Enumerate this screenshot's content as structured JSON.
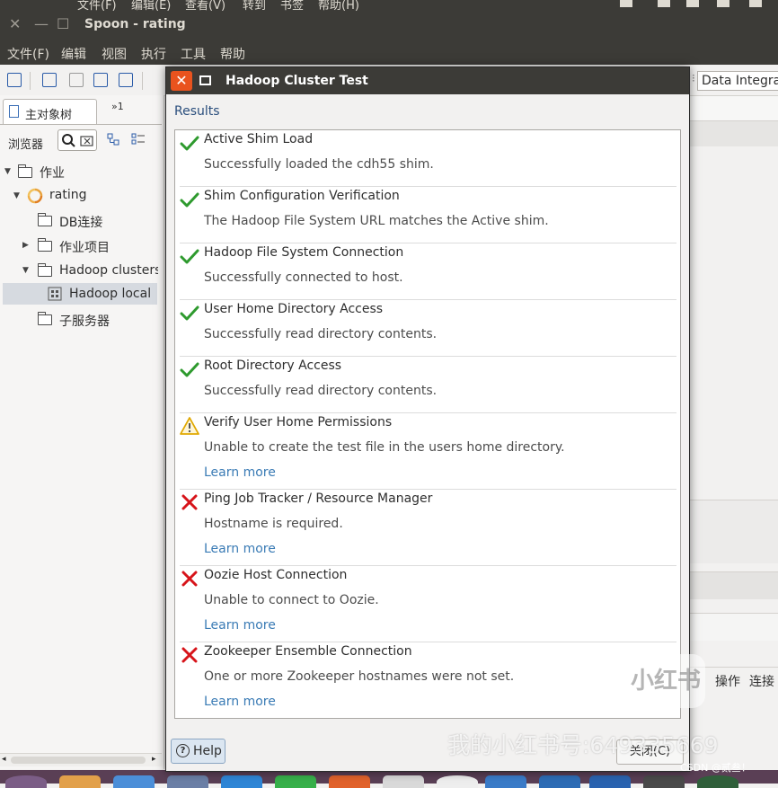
{
  "system_menu": [
    "文件(F)",
    "编辑(E)",
    "查看(V)",
    "转到",
    "书签",
    "帮助(H)"
  ],
  "window": {
    "title": "Spoon - rating"
  },
  "menubar": [
    "文件(F)",
    "编辑",
    "视图",
    "执行",
    "工具",
    "帮助"
  ],
  "right_panel": {
    "perspective": "Data Integration",
    "btn_text": "操作",
    "btn_text2": "连接"
  },
  "left_panel": {
    "tab_main": "主对象树",
    "tab_more": "»1",
    "browser_label": "浏览器",
    "tree": [
      {
        "label": "作业",
        "expanded": true
      },
      {
        "label": "rating",
        "expanded": true
      },
      {
        "label": "DB连接"
      },
      {
        "label": "作业项目",
        "expanded": false
      },
      {
        "label": "Hadoop clusters",
        "expanded": true
      },
      {
        "label": "Hadoop local",
        "selected": true
      },
      {
        "label": "子服务器"
      }
    ]
  },
  "dialog": {
    "title": "Hadoop Cluster Test",
    "results_label": "Results",
    "items": [
      {
        "name": "Active Shim Load",
        "message": "Successfully loaded the cdh55 shim.",
        "status": "success"
      },
      {
        "name": "Shim Configuration Verification",
        "message": "The Hadoop File System URL matches the Active shim.",
        "status": "success"
      },
      {
        "name": "Hadoop File System Connection",
        "message": "Successfully connected to host.",
        "status": "success"
      },
      {
        "name": "User Home Directory Access",
        "message": "Successfully read directory contents.",
        "status": "success"
      },
      {
        "name": "Root Directory Access",
        "message": "Successfully read directory contents.",
        "status": "success"
      },
      {
        "name": "Verify User Home Permissions",
        "message": "Unable to create the test file in the users home directory.",
        "status": "warning",
        "link": "Learn more"
      },
      {
        "name": "Ping Job Tracker / Resource Manager",
        "message": "Hostname is required.",
        "status": "error",
        "link": "Learn more"
      },
      {
        "name": "Oozie Host Connection",
        "message": "Unable to connect to Oozie.",
        "status": "error",
        "link": "Learn more"
      },
      {
        "name": "Zookeeper Ensemble Connection",
        "message": "One or more Zookeeper hostnames were not set.",
        "status": "error",
        "link": "Learn more"
      }
    ],
    "help_label": "Help",
    "close_label": "关闭(C)"
  },
  "watermark": {
    "text": "我的小红书号:649335669",
    "logo": "小红书",
    "csdn": "CSDN @贰叁！"
  },
  "colors": {
    "success": "#2e9a2e",
    "warning": "#e0a800",
    "error": "#d7141a",
    "link": "#3a7bb5",
    "accent": "#e9531e"
  }
}
